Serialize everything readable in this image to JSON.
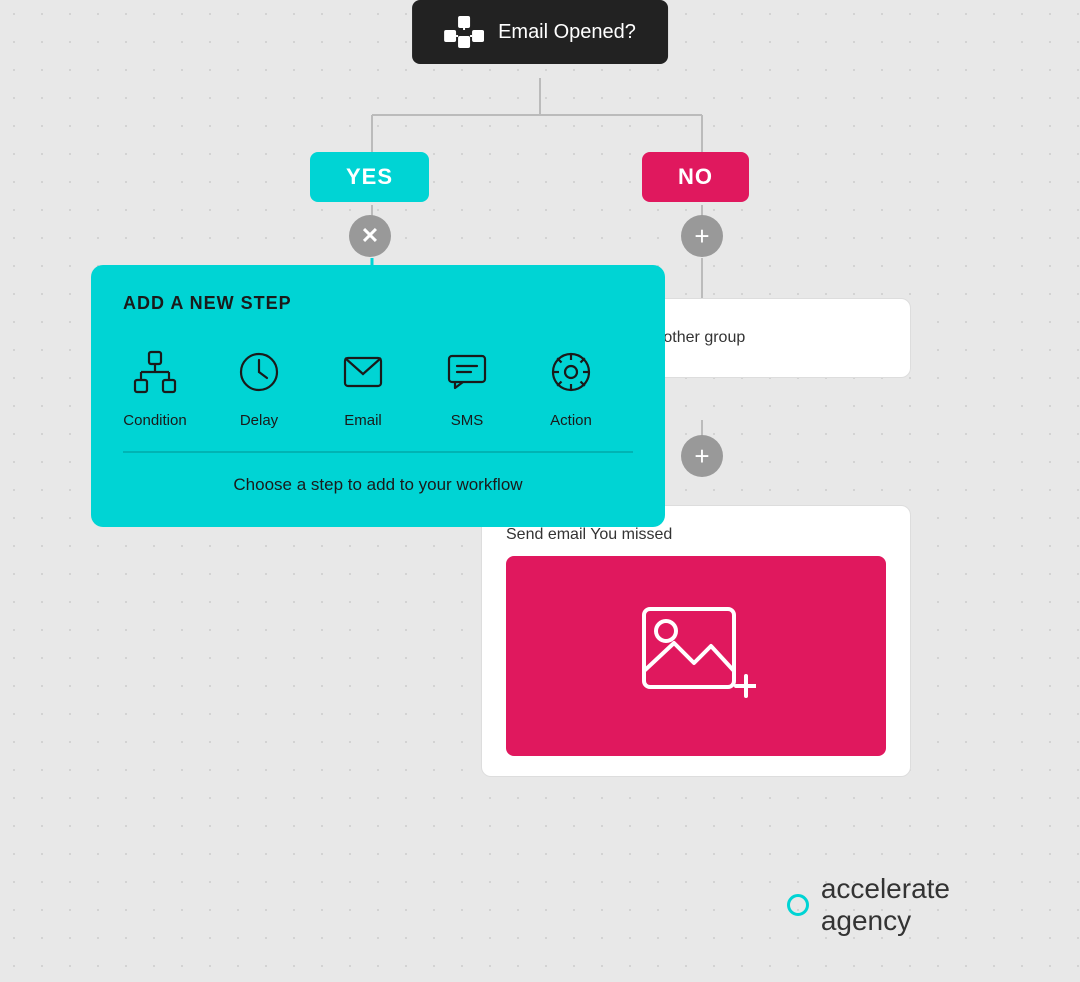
{
  "emailNode": {
    "label": "Email Opened?"
  },
  "yesButton": {
    "label": "YES"
  },
  "noButton": {
    "label": "NO"
  },
  "addStepPanel": {
    "title": "ADD A NEW STEP",
    "items": [
      {
        "id": "condition",
        "label": "Condition"
      },
      {
        "id": "delay",
        "label": "Delay"
      },
      {
        "id": "email",
        "label": "Email"
      },
      {
        "id": "sms",
        "label": "SMS"
      },
      {
        "id": "action",
        "label": "Action"
      }
    ],
    "helperText": "Choose a step to add to your workflow"
  },
  "moveSubscriberCard": {
    "text": "Move subscriber to another group"
  },
  "sendEmailCard": {
    "title": "Send email You missed"
  },
  "agencyLogo": {
    "name1": "accelerate",
    "name2": "agency"
  }
}
